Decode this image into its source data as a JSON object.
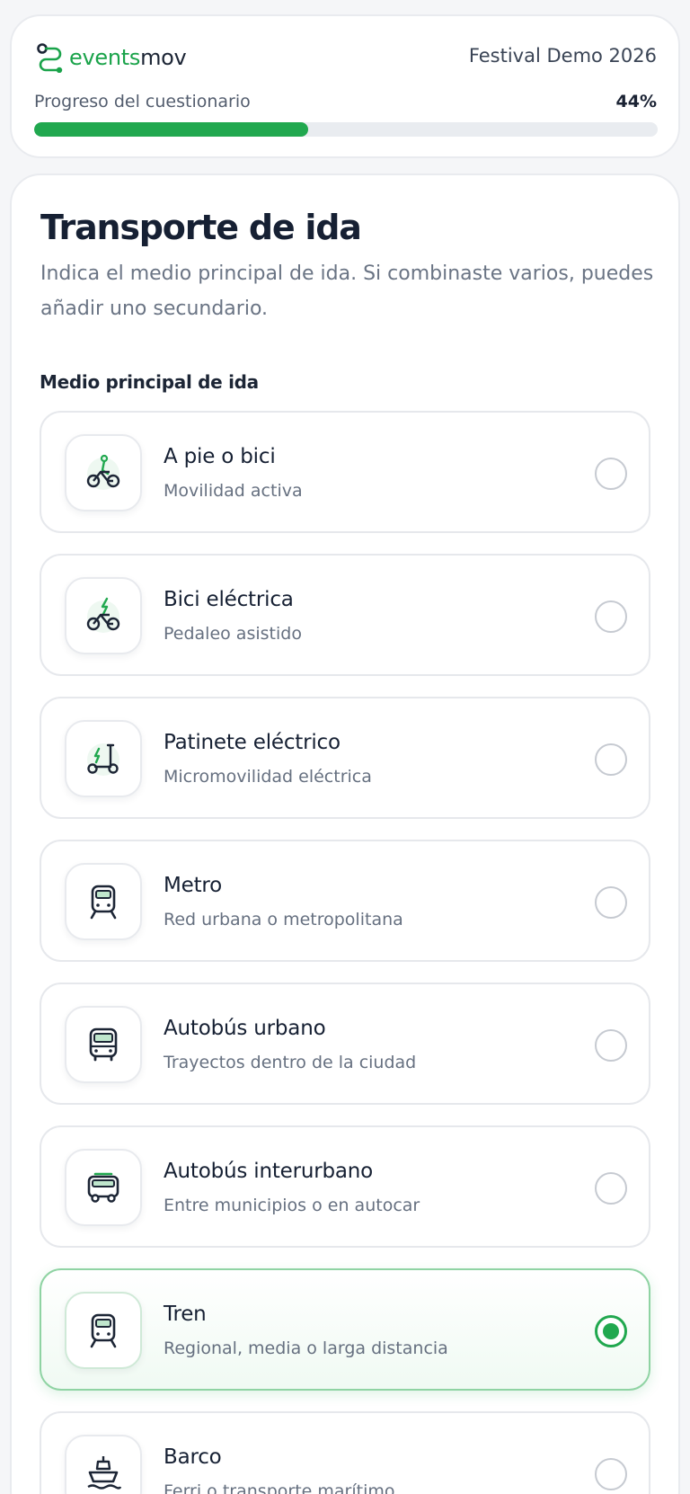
{
  "header": {
    "logo_part1": "events",
    "logo_part2": "mov",
    "event_name": "Festival Demo 2026",
    "progress_label": "Progreso del cuestionario",
    "progress_text": "44%",
    "progress_fraction": 0.44
  },
  "colors": {
    "accent": "#21a84f",
    "text_dark": "#162033",
    "text_muted": "#667080",
    "selected_border": "#8fd3a3"
  },
  "section": {
    "title": "Transporte de ida",
    "subtitle": "Indica el medio principal de ida. Si combinaste varios, puedes añadir uno secundario.",
    "field_label": "Medio principal de ida"
  },
  "options": [
    {
      "icon": "walk-bike-icon",
      "title": "A pie o bici",
      "subtitle": "Movilidad activa",
      "selected": false
    },
    {
      "icon": "e-bike-icon",
      "title": "Bici eléctrica",
      "subtitle": "Pedaleo asistido",
      "selected": false
    },
    {
      "icon": "e-scooter-icon",
      "title": "Patinete eléctrico",
      "subtitle": "Micromovilidad eléctrica",
      "selected": false
    },
    {
      "icon": "metro-icon",
      "title": "Metro",
      "subtitle": "Red urbana o metropolitana",
      "selected": false
    },
    {
      "icon": "bus-icon",
      "title": "Autobús urbano",
      "subtitle": "Trayectos dentro de la ciudad",
      "selected": false
    },
    {
      "icon": "coach-icon",
      "title": "Autobús interurbano",
      "subtitle": "Entre municipios o en autocar",
      "selected": false
    },
    {
      "icon": "train-icon",
      "title": "Tren",
      "subtitle": "Regional, media o larga distancia",
      "selected": true
    },
    {
      "icon": "ship-icon",
      "title": "Barco",
      "subtitle": "Ferri o transporte marítimo",
      "selected": false
    }
  ]
}
